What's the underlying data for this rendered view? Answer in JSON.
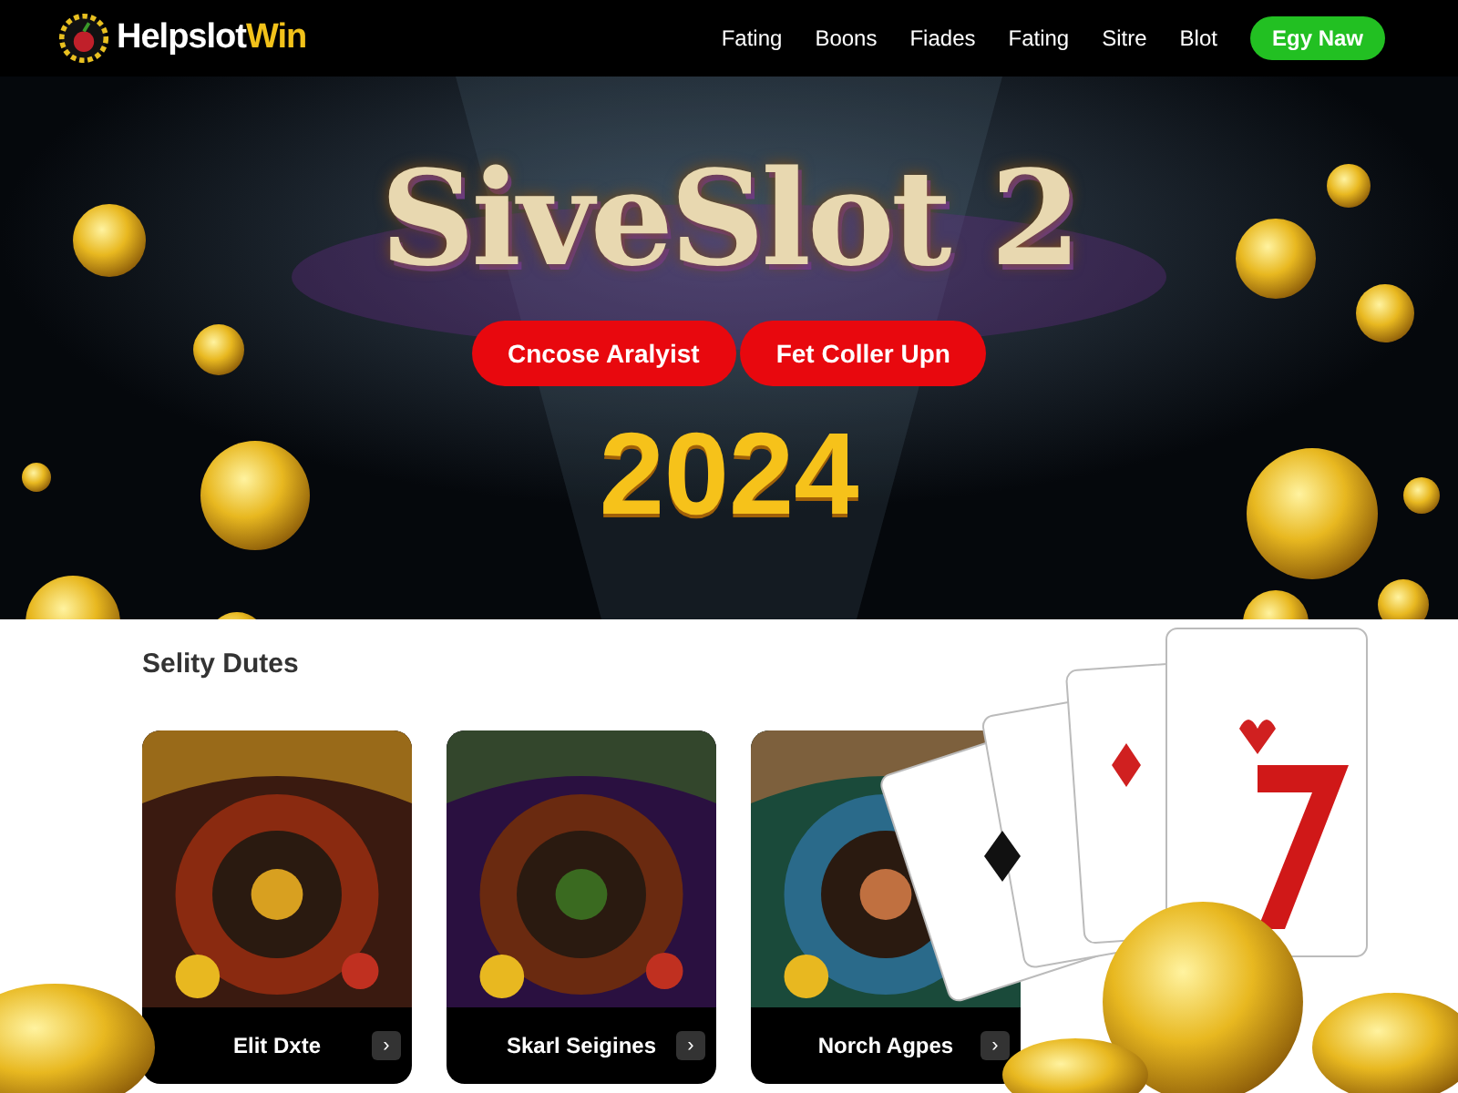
{
  "header": {
    "logo": {
      "name": "Helpslot",
      "accent": "Win"
    },
    "nav": [
      {
        "label": "Fating"
      },
      {
        "label": "Boons"
      },
      {
        "label": "Fiades"
      },
      {
        "label": "Fating"
      },
      {
        "label": "Sitre"
      },
      {
        "label": "Blot"
      }
    ],
    "cta": "Egy Naw"
  },
  "hero": {
    "title": "SiveSlot 2",
    "buttons": [
      "Cncose Aralyist",
      "Fet Coller Upn"
    ],
    "year": "2024"
  },
  "section": {
    "title": "Selity Dutes",
    "cards": [
      {
        "caption": "Elit Dxte",
        "arrow": "›"
      },
      {
        "caption": "Skarl Seigines",
        "arrow": "›"
      },
      {
        "caption": "Norch Agpes",
        "arrow": "›"
      }
    ]
  }
}
